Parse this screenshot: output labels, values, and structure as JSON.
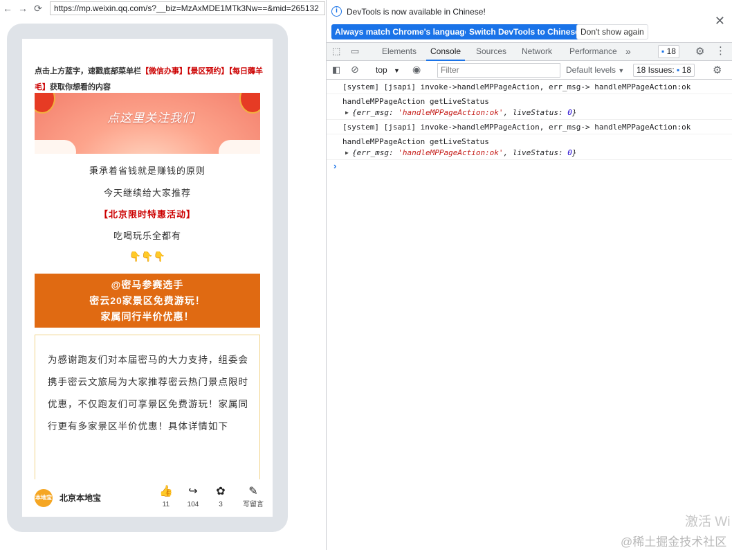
{
  "browser": {
    "url": "https://mp.weixin.qq.com/s?__biz=MzAxMDE1MTk3Nw==&mid=265132",
    "back_glyph": "←",
    "forward_glyph": "→",
    "reload_glyph": "⟳"
  },
  "article": {
    "intro_prefix": "点击上方蓝字，速戳底部菜单栏",
    "intro_hl1": "【微信办事】",
    "intro_hl2": "【景区预约】",
    "intro_hl3": "【每日薅羊毛】",
    "intro_suffix": "获取你想看的内容",
    "banner_text": "点这里关注我们",
    "line1": "秉承着省钱就是赚钱的原则",
    "line2": "今天继续给大家推荐",
    "line3": "【北京限时特惠活动】",
    "line4": "吃喝玩乐全都有",
    "emoji": "👇👇👇",
    "orange_line1": "@密马参赛选手",
    "orange_line2": "密云20家景区免费游玩！",
    "orange_line3": "家属同行半价优惠！",
    "body": "为感谢跑友们对本届密马的大力支持，组委会携手密云文旅局为大家推荐密云热门景点限时优惠，不仅跑友们可享景区免费游玩！家属同行更有多家景区半价优惠！具体详情如下",
    "colors": {
      "accent_red": "#cc0000",
      "orange_box": "#e06a12",
      "box_border": "#f1d38a"
    }
  },
  "bottom_bar": {
    "account_name": "北京本地宝",
    "avatar_text": "本地宝",
    "like_count": "11",
    "share_count": "104",
    "wow_count": "3",
    "comment_label": "写留言",
    "icons": {
      "like": "👍",
      "share": "↪",
      "wow": "✿",
      "comment": "✎"
    }
  },
  "devtools": {
    "info_message": "DevTools is now available in Chinese!",
    "btn_match": "Always match Chrome's language",
    "btn_switch": "Switch DevTools to Chinese",
    "btn_dismiss": "Don't show again",
    "close_glyph": "✕",
    "tabs": [
      "Elements",
      "Console",
      "Sources",
      "Network",
      "Performance"
    ],
    "more_tabs_glyph": "»",
    "message_badge_count": "18",
    "context": "top",
    "filter_placeholder": "Filter",
    "levels_label": "Default levels",
    "issues_label": "18 Issues:",
    "issues_count": "18",
    "logs": [
      {
        "text": "[system] [jsapi] invoke->handleMPPageAction, err_msg-> handleMPPageAction:ok"
      },
      {
        "text": "handleMPPageAction getLiveStatus",
        "obj_key1": "err_msg",
        "obj_val1": "'handleMPPageAction:ok'",
        "obj_key2": "liveStatus",
        "obj_val2": "0"
      },
      {
        "text": "[system] [jsapi] invoke->handleMPPageAction, err_msg-> handleMPPageAction:ok"
      },
      {
        "text": "handleMPPageAction getLiveStatus",
        "obj_key1": "err_msg",
        "obj_val1": "'handleMPPageAction:ok'",
        "obj_key2": "liveStatus",
        "obj_val2": "0"
      }
    ],
    "prompt_glyph": "›"
  },
  "watermark": {
    "activate": "激活 Wi",
    "community": "@稀土掘金技术社区"
  }
}
